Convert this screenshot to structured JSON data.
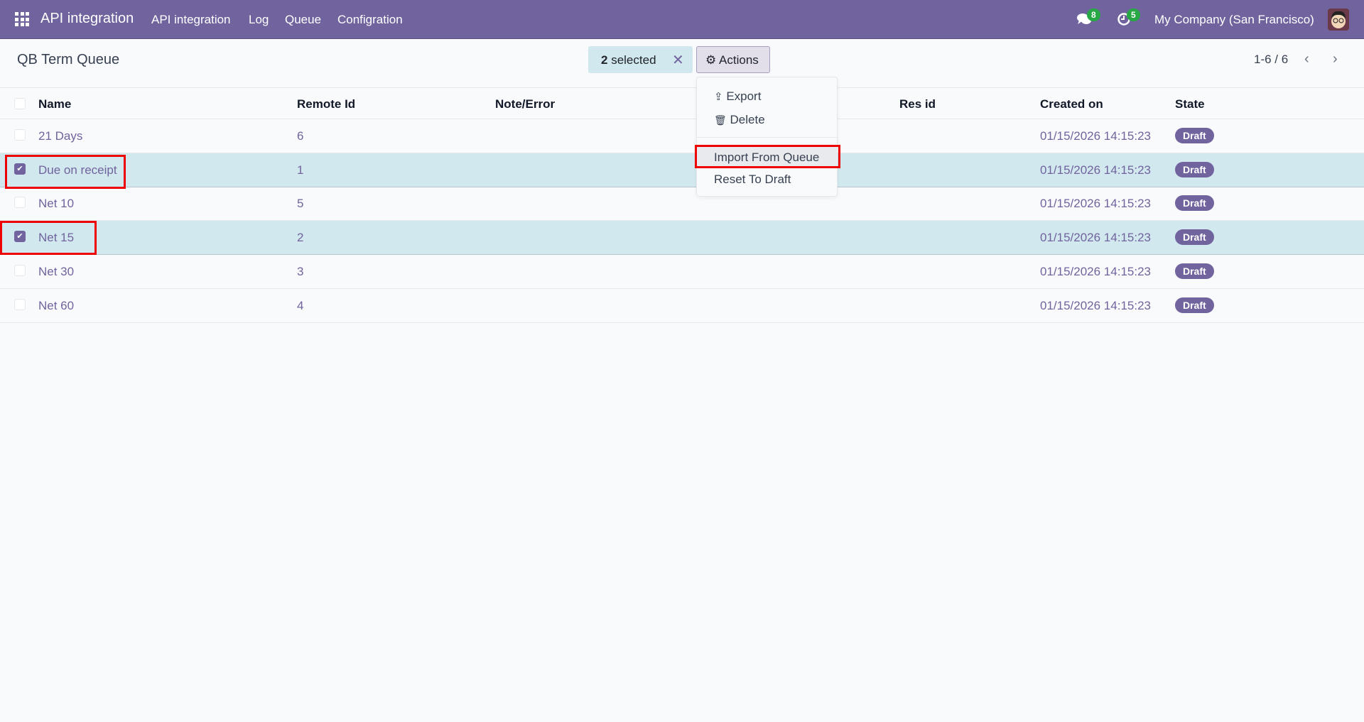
{
  "topbar": {
    "app_name": "API integration",
    "menu": [
      "API integration",
      "Log",
      "Queue",
      "Configration"
    ],
    "messages_count": "8",
    "activities_count": "5",
    "company": "My Company (San Francisco)"
  },
  "control": {
    "title": "QB Term Queue",
    "selected_count": "2",
    "selected_label": "selected",
    "actions_label": "Actions",
    "pager": "1-6 / 6"
  },
  "actions_menu": {
    "export": "Export",
    "delete": "Delete",
    "import_from_queue": "Import From Queue",
    "reset_to_draft": "Reset To Draft"
  },
  "table": {
    "headers": {
      "name": "Name",
      "remote_id": "Remote Id",
      "note_error": "Note/Error",
      "res_id": "Res id",
      "created_on": "Created on",
      "state": "State"
    },
    "rows": [
      {
        "name": "21 Days",
        "remote_id": "6",
        "created_on": "01/15/2026 14:15:23",
        "state": "Draft",
        "selected": false
      },
      {
        "name": "Due on receipt",
        "remote_id": "1",
        "created_on": "01/15/2026 14:15:23",
        "state": "Draft",
        "selected": true
      },
      {
        "name": "Net 10",
        "remote_id": "5",
        "created_on": "01/15/2026 14:15:23",
        "state": "Draft",
        "selected": false
      },
      {
        "name": "Net 15",
        "remote_id": "2",
        "created_on": "01/15/2026 14:15:23",
        "state": "Draft",
        "selected": true
      },
      {
        "name": "Net 30",
        "remote_id": "3",
        "created_on": "01/15/2026 14:15:23",
        "state": "Draft",
        "selected": false
      },
      {
        "name": "Net 60",
        "remote_id": "4",
        "created_on": "01/15/2026 14:15:23",
        "state": "Draft",
        "selected": false
      }
    ]
  },
  "colors": {
    "brand": "#71639e",
    "selected_row": "#d1e8ee",
    "highlight": "#ee0000",
    "badge_green": "#28a745"
  }
}
